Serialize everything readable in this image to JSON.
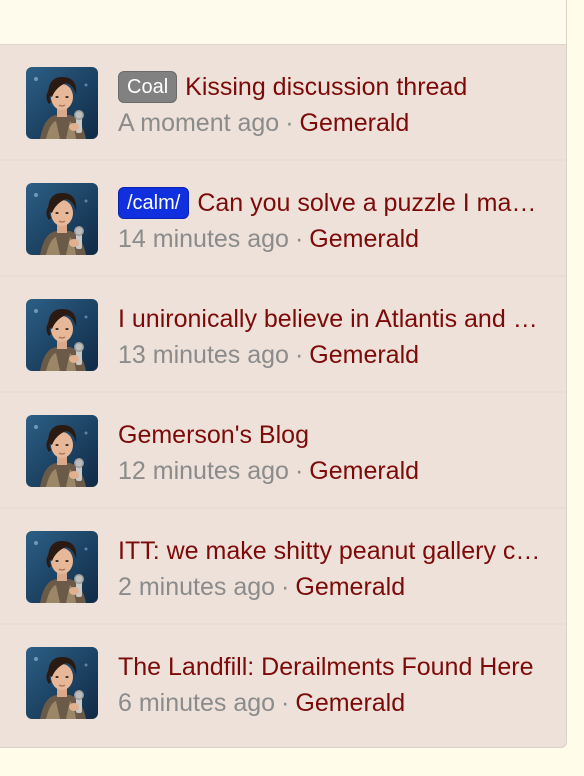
{
  "threads": [
    {
      "badge": "Coal",
      "badge_color": "#818181",
      "title": "Kissing discussion thread",
      "time": "A moment ago",
      "author": "Gemerald"
    },
    {
      "badge": "/calm/",
      "badge_color": "#1030e0",
      "title": "Can you solve a puzzle I made?",
      "time": "14 minutes ago",
      "author": "Gemerald"
    },
    {
      "badge": "",
      "title": "I unironically believe in Atlantis and Lemuria",
      "time": "13 minutes ago",
      "author": "Gemerald"
    },
    {
      "badge": "",
      "title": "Gemerson's Blog",
      "time": "12 minutes ago",
      "author": "Gemerald"
    },
    {
      "badge": "",
      "title": "ITT: we make shitty peanut gallery comments",
      "time": "2 minutes ago",
      "author": "Gemerald"
    },
    {
      "badge": "",
      "title": "The Landfill: Derailments Found Here",
      "time": "6 minutes ago",
      "author": "Gemerald"
    }
  ],
  "separator": "·",
  "colors": {
    "link": "#7c0a08",
    "muted": "#8b8b8b",
    "row_bg": "#ede1da",
    "page_bg": "#fffde9"
  },
  "icons": {
    "avatar": "user-avatar-photo"
  }
}
